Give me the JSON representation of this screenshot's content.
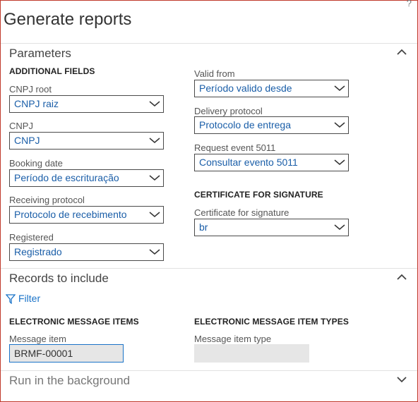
{
  "page": {
    "title": "Generate reports",
    "help_label": "?"
  },
  "parameters": {
    "title": "Parameters",
    "additional_fields_heading": "ADDITIONAL FIELDS",
    "cnpj_root": {
      "label": "CNPJ root",
      "value": "CNPJ raiz"
    },
    "cnpj": {
      "label": "CNPJ",
      "value": "CNPJ"
    },
    "booking_date": {
      "label": "Booking date",
      "value": "Período de escrituração"
    },
    "receiving_protocol": {
      "label": "Receiving protocol",
      "value": "Protocolo de recebimento"
    },
    "registered": {
      "label": "Registered",
      "value": "Registrado"
    },
    "valid_from": {
      "label": "Valid from",
      "value": "Período valido desde"
    },
    "delivery_protocol": {
      "label": "Delivery protocol",
      "value": "Protocolo de entrega"
    },
    "request_event": {
      "label": "Request event 5011",
      "value": "Consultar evento 5011"
    },
    "certificate_heading": "CERTIFICATE FOR SIGNATURE",
    "certificate": {
      "label": "Certificate for signature",
      "value": "br"
    }
  },
  "records": {
    "title": "Records to include",
    "filter_label": "Filter",
    "items_heading": "ELECTRONIC MESSAGE ITEMS",
    "item_types_heading": "ELECTRONIC MESSAGE ITEM TYPES",
    "message_item": {
      "label": "Message item",
      "value": "BRMF-00001"
    },
    "message_item_type": {
      "label": "Message item type",
      "value": ""
    }
  },
  "background": {
    "title": "Run in the background"
  },
  "colors": {
    "accent": "#1a73c8",
    "value_text": "#1a5ea8",
    "frame_border": "#c0392b"
  },
  "icons": {
    "collapse": "chevron-up-icon",
    "expand": "chevron-down-icon",
    "dropdown": "chevron-down-icon",
    "filter": "filter-icon"
  }
}
